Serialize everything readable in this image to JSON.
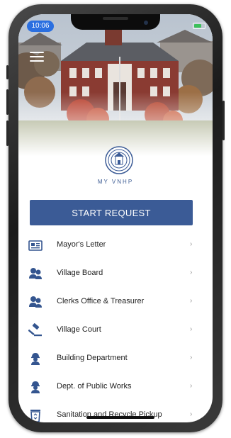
{
  "status_bar": {
    "time": "10:06",
    "battery_icon": "battery-charging-icon"
  },
  "header": {
    "menu_icon": "hamburger-menu-icon",
    "brand": "MY VNHP",
    "seal_icon": "village-seal-icon"
  },
  "start_button": {
    "label": "START REQUEST"
  },
  "menu": {
    "items": [
      {
        "label": "Mayor's Letter",
        "icon": "letter-icon"
      },
      {
        "label": "Village Board",
        "icon": "people-group-icon"
      },
      {
        "label": "Clerks Office & Treasurer",
        "icon": "people-group-icon"
      },
      {
        "label": "Village Court",
        "icon": "gavel-icon"
      },
      {
        "label": "Building Department",
        "icon": "worker-icon"
      },
      {
        "label": "Dept. of Public Works",
        "icon": "worker-icon"
      },
      {
        "label": "Sanitation and Recycle Pickup",
        "icon": "recycle-bin-icon"
      }
    ],
    "chevron": "›"
  },
  "colors": {
    "accent": "#3b5b96",
    "brand_text": "#3e5d94",
    "icon": "#34558f",
    "time_pill": "#2a6fe0"
  }
}
